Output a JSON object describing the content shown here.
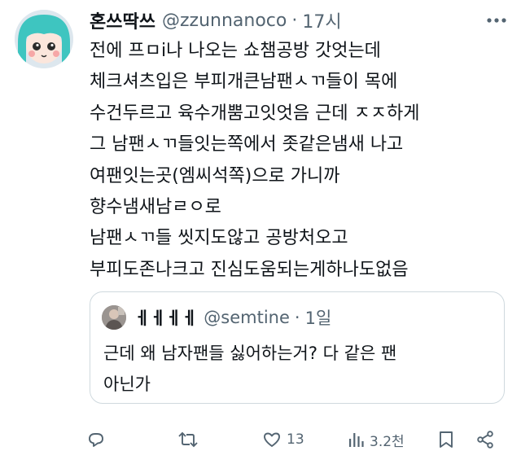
{
  "tweet": {
    "author_name": "혼쓰딱쓰",
    "handle": "@zzunnanoco",
    "separator": "·",
    "time": "17시",
    "lines": [
      "전에 프ㅁi나 나오는 쇼챔공방 갓엇는데",
      "체크셔츠입은 부피개큰남팬ㅅㄲ들이 목에",
      "수건두르고 육수개뿜고잇엇음 근데 ㅈㅈ하게",
      "그 남팬ㅅㄲ들잇는쪽에서 좃같은냄새 나고",
      "여팬잇는곳(엠씨석쪽)으로 가니까",
      "향수냄새남ㄹㅇ로",
      "남팬ㅅㄲ들 씻지도않고 공방처오고",
      "부피도존나크고 진심도움되는게하나도없음"
    ]
  },
  "quote": {
    "author_name": "ㅔㅔㅔㅔ",
    "handle": "@semtine",
    "separator": "·",
    "time": "1일",
    "lines": [
      "근데 왜 남자팬들 싫어하는거? 다 같은 팬",
      "아닌가"
    ]
  },
  "actions": {
    "reply": {
      "icon": "reply-icon",
      "count": ""
    },
    "retweet": {
      "icon": "retweet-icon",
      "count": ""
    },
    "like": {
      "icon": "heart-icon",
      "count": "13"
    },
    "views": {
      "icon": "views-icon",
      "count": "3.2천"
    },
    "bookmark": {
      "icon": "bookmark-icon",
      "count": ""
    },
    "share": {
      "icon": "share-icon",
      "count": ""
    }
  },
  "colors": {
    "text": "#0f1419",
    "secondary": "#536471",
    "border": "#cfd9de",
    "avatar_hair": "#3ec5c0"
  }
}
